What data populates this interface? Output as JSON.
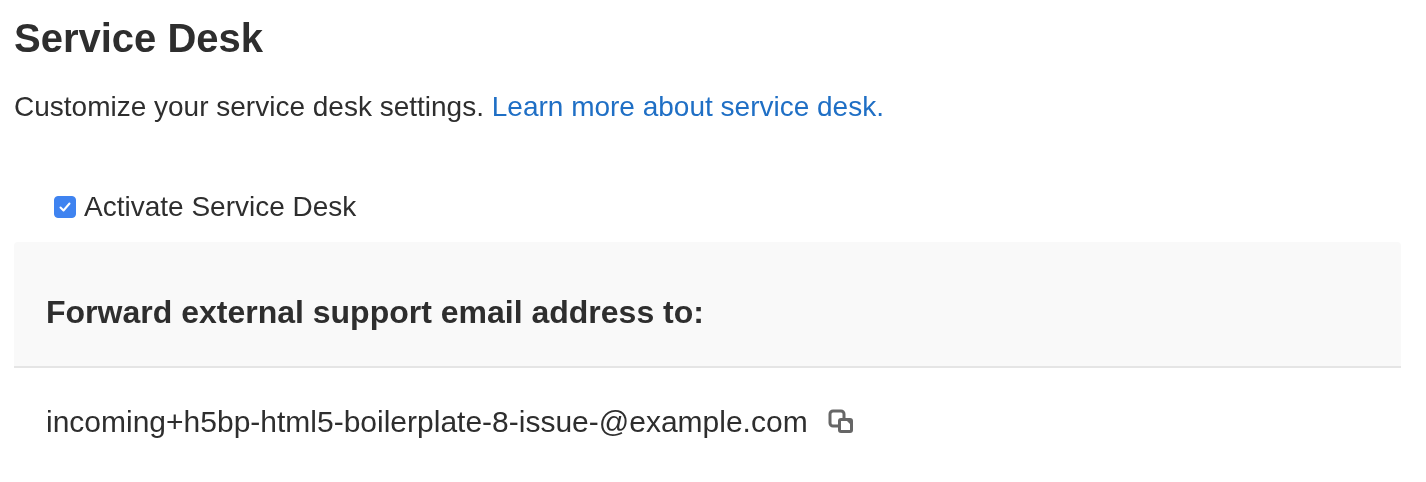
{
  "title": "Service Desk",
  "description": {
    "text": "Customize your service desk settings.",
    "link": "Learn more about service desk."
  },
  "activate": {
    "label": "Activate Service Desk",
    "checked": true
  },
  "panel": {
    "heading": "Forward external support email address to:",
    "email": "incoming+h5bp-html5-boilerplate-8-issue-@example.com"
  }
}
